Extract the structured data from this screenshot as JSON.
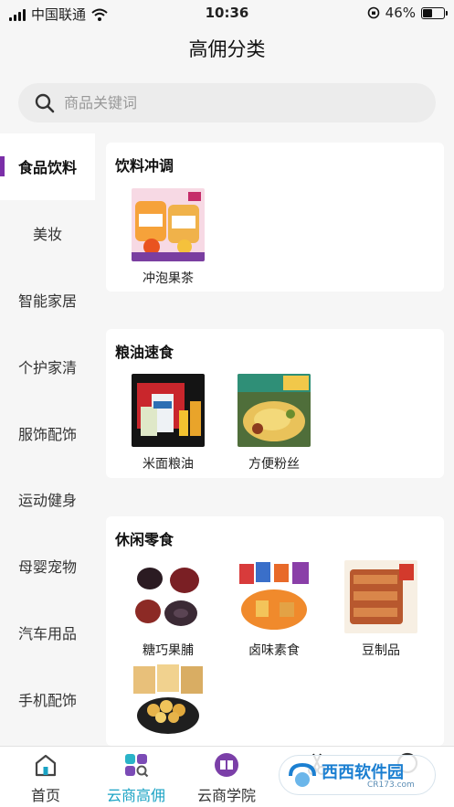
{
  "status_bar": {
    "carrier": "中国联通",
    "time": "10:36",
    "battery": "46%",
    "battery_level": 0.46
  },
  "header": {
    "title": "高佣分类"
  },
  "search": {
    "placeholder": "商品关键词"
  },
  "sidebar": {
    "items": [
      {
        "label": "食品饮料",
        "active": true
      },
      {
        "label": "美妆"
      },
      {
        "label": "智能家居"
      },
      {
        "label": "个护家清"
      },
      {
        "label": "服饰配饰"
      },
      {
        "label": "运动健身"
      },
      {
        "label": "母婴宠物"
      },
      {
        "label": "汽车用品"
      },
      {
        "label": "手机配饰"
      }
    ]
  },
  "sections": [
    {
      "title": "饮料冲调",
      "items": [
        {
          "label": "冲泡果茶"
        }
      ]
    },
    {
      "title": "粮油速食",
      "items": [
        {
          "label": "米面粮油"
        },
        {
          "label": "方便粉丝"
        }
      ]
    },
    {
      "title": "休闲零食",
      "items": [
        {
          "label": "糖巧果脯"
        },
        {
          "label": "卤味素食"
        },
        {
          "label": "豆制品"
        },
        {
          "label": ""
        }
      ]
    }
  ],
  "tabbar": {
    "items": [
      {
        "label": "首页",
        "icon": "home-icon"
      },
      {
        "label": "云商高佣",
        "icon": "category-search-icon",
        "active": true
      },
      {
        "label": "云商学院",
        "icon": "academy-icon"
      },
      {
        "label": "",
        "icon": "scissors-icon"
      },
      {
        "label": "",
        "icon": "profile-icon"
      }
    ]
  },
  "watermark": {
    "text": "西西软件园",
    "sub": "CR173.com"
  },
  "colors": {
    "accent_purple": "#7b2fa8",
    "tab_active": "#1aa3c4"
  }
}
